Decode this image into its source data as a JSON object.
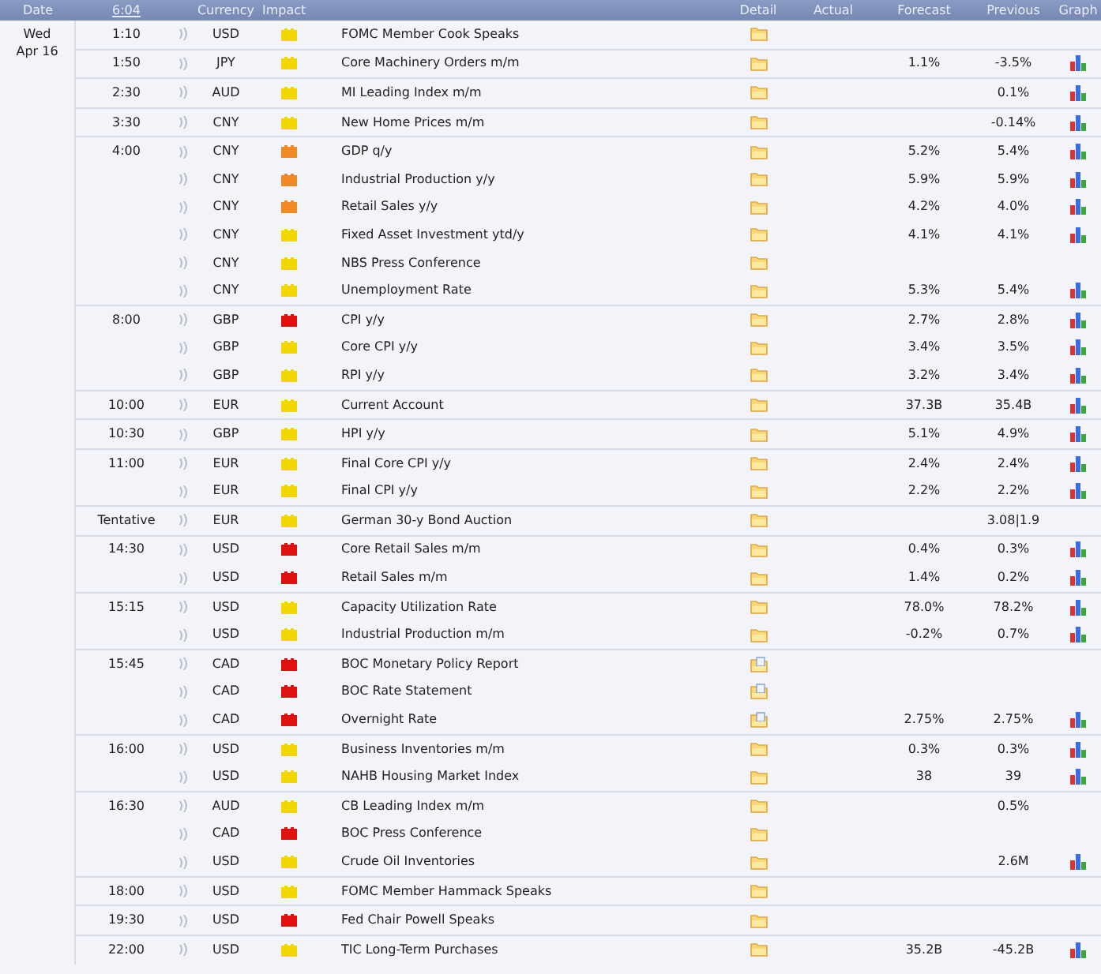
{
  "header": {
    "date": "Date",
    "time": "6:04",
    "currency": "Currency",
    "impact": "Impact",
    "detail": "Detail",
    "actual": "Actual",
    "forecast": "Forecast",
    "previous": "Previous",
    "graph": "Graph"
  },
  "day": {
    "weekday": "Wed",
    "date": "Apr 16"
  },
  "groups": [
    {
      "time": "1:10",
      "events": [
        {
          "currency": "USD",
          "color": "#f2d600",
          "title": "FOMC Member Cook Speaks",
          "detail": {
            "kind": "folder"
          },
          "graph": false
        }
      ]
    },
    {
      "time": "1:50",
      "events": [
        {
          "currency": "JPY",
          "color": "#f2d600",
          "title": "Core Machinery Orders m/m",
          "detail": {
            "kind": "folder"
          },
          "forecast": "1.1%",
          "previous": "-3.5%",
          "graph": true
        }
      ]
    },
    {
      "time": "2:30",
      "events": [
        {
          "currency": "AUD",
          "color": "#f2d600",
          "title": "MI Leading Index m/m",
          "detail": {
            "kind": "folder"
          },
          "previous": "0.1%",
          "graph": true
        }
      ]
    },
    {
      "time": "3:30",
      "events": [
        {
          "currency": "CNY",
          "color": "#f2d600",
          "title": "New Home Prices m/m",
          "detail": {
            "kind": "folder"
          },
          "previous": "-0.14%",
          "graph": true
        }
      ]
    },
    {
      "time": "4:00",
      "events": [
        {
          "currency": "CNY",
          "color": "#f08a24",
          "title": "GDP q/y",
          "detail": {
            "kind": "folder"
          },
          "forecast": "5.2%",
          "previous": "5.4%",
          "graph": true
        },
        {
          "currency": "CNY",
          "color": "#f08a24",
          "title": "Industrial Production y/y",
          "detail": {
            "kind": "folder"
          },
          "forecast": "5.9%",
          "previous": "5.9%",
          "graph": true
        },
        {
          "currency": "CNY",
          "color": "#f08a24",
          "title": "Retail Sales y/y",
          "detail": {
            "kind": "folder"
          },
          "forecast": "4.2%",
          "previous": "4.0%",
          "graph": true
        },
        {
          "currency": "CNY",
          "color": "#f2d600",
          "title": "Fixed Asset Investment ytd/y",
          "detail": {
            "kind": "folder"
          },
          "forecast": "4.1%",
          "previous": "4.1%",
          "graph": true
        },
        {
          "currency": "CNY",
          "color": "#f2d600",
          "title": "NBS Press Conference",
          "detail": {
            "kind": "folder"
          },
          "graph": false
        },
        {
          "currency": "CNY",
          "color": "#f2d600",
          "title": "Unemployment Rate",
          "detail": {
            "kind": "folder"
          },
          "forecast": "5.3%",
          "previous": "5.4%",
          "graph": true
        }
      ]
    },
    {
      "time": "8:00",
      "events": [
        {
          "currency": "GBP",
          "color": "#e01010",
          "title": "CPI y/y",
          "detail": {
            "kind": "folder"
          },
          "forecast": "2.7%",
          "previous": "2.8%",
          "graph": true
        },
        {
          "currency": "GBP",
          "color": "#f2d600",
          "title": "Core CPI y/y",
          "detail": {
            "kind": "folder"
          },
          "forecast": "3.4%",
          "previous": "3.5%",
          "graph": true
        },
        {
          "currency": "GBP",
          "color": "#f2d600",
          "title": "RPI y/y",
          "detail": {
            "kind": "folder"
          },
          "forecast": "3.2%",
          "previous": "3.4%",
          "graph": true
        }
      ]
    },
    {
      "time": "10:00",
      "events": [
        {
          "currency": "EUR",
          "color": "#f2d600",
          "title": "Current Account",
          "detail": {
            "kind": "folder"
          },
          "forecast": "37.3B",
          "previous": "35.4B",
          "graph": true
        }
      ]
    },
    {
      "time": "10:30",
      "events": [
        {
          "currency": "GBP",
          "color": "#f2d600",
          "title": "HPI y/y",
          "detail": {
            "kind": "folder"
          },
          "forecast": "5.1%",
          "previous": "4.9%",
          "graph": true
        }
      ]
    },
    {
      "time": "11:00",
      "events": [
        {
          "currency": "EUR",
          "color": "#f2d600",
          "title": "Final Core CPI y/y",
          "detail": {
            "kind": "folder"
          },
          "forecast": "2.4%",
          "previous": "2.4%",
          "graph": true
        },
        {
          "currency": "EUR",
          "color": "#f2d600",
          "title": "Final CPI y/y",
          "detail": {
            "kind": "folder"
          },
          "forecast": "2.2%",
          "previous": "2.2%",
          "graph": true
        }
      ]
    },
    {
      "time": "Tentative",
      "events": [
        {
          "currency": "EUR",
          "color": "#f2d600",
          "title": "German 30-y Bond Auction",
          "detail": {
            "kind": "folder"
          },
          "previous": "3.08|1.9",
          "graph": false
        }
      ]
    },
    {
      "time": "14:30",
      "events": [
        {
          "currency": "USD",
          "color": "#e01010",
          "title": "Core Retail Sales m/m",
          "detail": {
            "kind": "folder"
          },
          "forecast": "0.4%",
          "previous": "0.3%",
          "graph": true
        },
        {
          "currency": "USD",
          "color": "#e01010",
          "title": "Retail Sales m/m",
          "detail": {
            "kind": "folder"
          },
          "forecast": "1.4%",
          "previous": "0.2%",
          "graph": true
        }
      ]
    },
    {
      "time": "15:15",
      "events": [
        {
          "currency": "USD",
          "color": "#f2d600",
          "title": "Capacity Utilization Rate",
          "detail": {
            "kind": "folder"
          },
          "forecast": "78.0%",
          "previous": "78.2%",
          "graph": true
        },
        {
          "currency": "USD",
          "color": "#f2d600",
          "title": "Industrial Production m/m",
          "detail": {
            "kind": "folder"
          },
          "forecast": "-0.2%",
          "previous": "0.7%",
          "graph": true
        }
      ]
    },
    {
      "time": "15:45",
      "events": [
        {
          "currency": "CAD",
          "color": "#e01010",
          "title": "BOC Monetary Policy Report",
          "detail": {
            "kind": "folder_doc"
          },
          "graph": false
        },
        {
          "currency": "CAD",
          "color": "#e01010",
          "title": "BOC Rate Statement",
          "detail": {
            "kind": "folder_doc"
          },
          "graph": false
        },
        {
          "currency": "CAD",
          "color": "#e01010",
          "title": "Overnight Rate",
          "detail": {
            "kind": "folder_doc"
          },
          "forecast": "2.75%",
          "previous": "2.75%",
          "graph": true
        }
      ]
    },
    {
      "time": "16:00",
      "events": [
        {
          "currency": "USD",
          "color": "#f2d600",
          "title": "Business Inventories m/m",
          "detail": {
            "kind": "folder"
          },
          "forecast": "0.3%",
          "previous": "0.3%",
          "graph": true
        },
        {
          "currency": "USD",
          "color": "#f2d600",
          "title": "NAHB Housing Market Index",
          "detail": {
            "kind": "folder"
          },
          "forecast": "38",
          "previous": "39",
          "graph": true
        }
      ]
    },
    {
      "time": "16:30",
      "events": [
        {
          "currency": "AUD",
          "color": "#f2d600",
          "title": "CB Leading Index m/m",
          "detail": {
            "kind": "folder"
          },
          "previous": "0.5%",
          "graph": false
        },
        {
          "currency": "CAD",
          "color": "#e01010",
          "title": "BOC Press Conference",
          "detail": {
            "kind": "folder"
          },
          "graph": false
        },
        {
          "currency": "USD",
          "color": "#f2d600",
          "title": "Crude Oil Inventories",
          "detail": {
            "kind": "folder"
          },
          "previous": "2.6M",
          "graph": true
        }
      ]
    },
    {
      "time": "18:00",
      "events": [
        {
          "currency": "USD",
          "color": "#f2d600",
          "title": "FOMC Member Hammack Speaks",
          "detail": {
            "kind": "folder"
          },
          "graph": false
        }
      ]
    },
    {
      "time": "19:30",
      "events": [
        {
          "currency": "USD",
          "color": "#e01010",
          "title": "Fed Chair Powell Speaks",
          "detail": {
            "kind": "folder"
          },
          "graph": false
        }
      ]
    },
    {
      "time": "22:00",
      "events": [
        {
          "currency": "USD",
          "color": "#f2d600",
          "title": "TIC Long-Term Purchases",
          "detail": {
            "kind": "folder"
          },
          "forecast": "35.2B",
          "previous": "-45.2B",
          "graph": true
        }
      ]
    }
  ]
}
